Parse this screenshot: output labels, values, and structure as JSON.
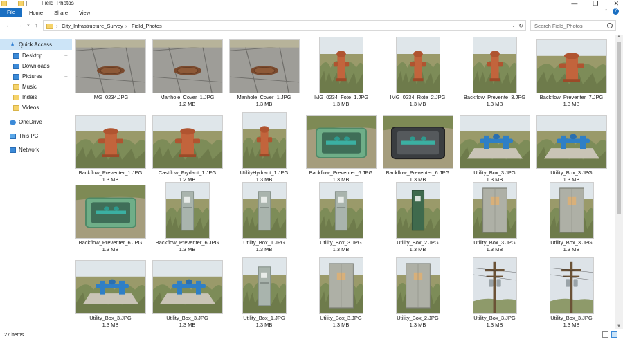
{
  "title_bar": {
    "title": "Field_Photos",
    "minimize": "—",
    "maximize": "❐",
    "close": "✕"
  },
  "ribbon": {
    "tabs": [
      "File",
      "Home",
      "Share",
      "View"
    ],
    "expand": "⌃",
    "help": "?"
  },
  "address": {
    "back": "←",
    "forward": "→",
    "recent": "⌄",
    "up": "↑",
    "crumbs": [
      "City_Infrastructure_Survey",
      "Field_Photos"
    ],
    "separator": "›",
    "dropdown": "⌄",
    "refresh": "↻",
    "search_placeholder": "Search Field_Photos"
  },
  "sidebar": {
    "items": [
      {
        "label": "Quick Access",
        "icon": "star-icon",
        "pinned": false
      },
      {
        "label": "Desktop",
        "icon": "desktop-icon",
        "pinned": true
      },
      {
        "label": "Downloads",
        "icon": "download-icon",
        "pinned": true
      },
      {
        "label": "Pictures",
        "icon": "pictures-icon",
        "pinned": true
      },
      {
        "label": "Music",
        "icon": "folder-icon",
        "pinned": false
      },
      {
        "label": "Indeis",
        "icon": "folder-icon",
        "pinned": false
      },
      {
        "label": "Videos",
        "icon": "folder-icon",
        "pinned": false
      },
      {
        "label": "OneDrive",
        "icon": "cloud-icon",
        "pinned": false
      },
      {
        "label": "This PC",
        "icon": "pc-icon",
        "pinned": false
      },
      {
        "label": "Network",
        "icon": "network-icon",
        "pinned": false
      }
    ],
    "pin_glyph": "📌"
  },
  "files": [
    {
      "name": "IMG_0234.JPG",
      "size": "",
      "kind": "manhole"
    },
    {
      "name": "Manhole_Cover_1.JPG",
      "size": "1.2 MB",
      "kind": "manhole"
    },
    {
      "name": "Manhole_Cover_1.JPG",
      "size": "1.3 MB",
      "kind": "manhole"
    },
    {
      "name": "IMG_0234_Fote_1.JPG",
      "size": "1.3 MB",
      "kind": "hydrant"
    },
    {
      "name": "IMG_0234_Rote_2.JPG",
      "size": "1.3 MB",
      "kind": "hydrant"
    },
    {
      "name": "Backflow_Prevente_3.JPG",
      "size": "1.3 MB",
      "kind": "hydrant"
    },
    {
      "name": "Backflow_Preventer_7.JPG",
      "size": "1.3 MB",
      "kind": "hydrant"
    },
    {
      "name": "Backflow_Preventer_1.JPG",
      "size": "1.3 MB",
      "kind": "hydrant"
    },
    {
      "name": "Castflow_Frydant_1.JPG",
      "size": "1.2 MB",
      "kind": "hydrant"
    },
    {
      "name": "UtilityHydrant_1.JPG",
      "size": "1.3 MB",
      "kind": "hydrant"
    },
    {
      "name": "Backflow_Preventer_6.JPG",
      "size": "1.3 MB",
      "kind": "valvebox"
    },
    {
      "name": "Backflow_Preventer_6.JPG",
      "size": "1.3 MB",
      "kind": "valvebox-dark"
    },
    {
      "name": "Utility_Box_3.JPG",
      "size": "1.3 MB",
      "kind": "bluepipe"
    },
    {
      "name": "Utility_Box_3.JPG",
      "size": "1.3 MB",
      "kind": "bluepipe"
    },
    {
      "name": "Backflow_Preventer_6.JPG",
      "size": "1.3 MB",
      "kind": "valvebox"
    },
    {
      "name": "Backflow_Preventer_6.JPG",
      "size": "1.3 MB",
      "kind": "pedestal"
    },
    {
      "name": "Utility_Box_1.JPG",
      "size": "1.3 MB",
      "kind": "pedestal"
    },
    {
      "name": "Utility_Box_3.JPG",
      "size": "1.3 MB",
      "kind": "pedestal"
    },
    {
      "name": "Utility_Box_2.JPG",
      "size": "1.3 MB",
      "kind": "pedestal-green"
    },
    {
      "name": "Utility_Box_3.JPG",
      "size": "1.3 MB",
      "kind": "cabinet"
    },
    {
      "name": "Utility_Box_3.JPG",
      "size": "1.3 MB",
      "kind": "cabinet"
    },
    {
      "name": "Utility_Box_3.JPG",
      "size": "1.3 MB",
      "kind": "bluepipe"
    },
    {
      "name": "Utility_Box_3.JPG",
      "size": "1.3 MB",
      "kind": "bluepipe"
    },
    {
      "name": "Utility_Box_1.JPG",
      "size": "1.3 MB",
      "kind": "pedestal"
    },
    {
      "name": "Utility_Box_3.JPG",
      "size": "1.3 MB",
      "kind": "cabinet"
    },
    {
      "name": "Utility_Box_2.JPG",
      "size": "1.3 MB",
      "kind": "cabinet"
    },
    {
      "name": "Utility_Box_3.JPG",
      "size": "1.3 MB",
      "kind": "pole"
    },
    {
      "name": "Utility_Box_3.JPG",
      "size": "1.3 MB",
      "kind": "pole"
    }
  ],
  "status": {
    "count": "27 items"
  },
  "colors": {
    "accent": "#1a6fc2",
    "selection": "#cce4f7"
  }
}
